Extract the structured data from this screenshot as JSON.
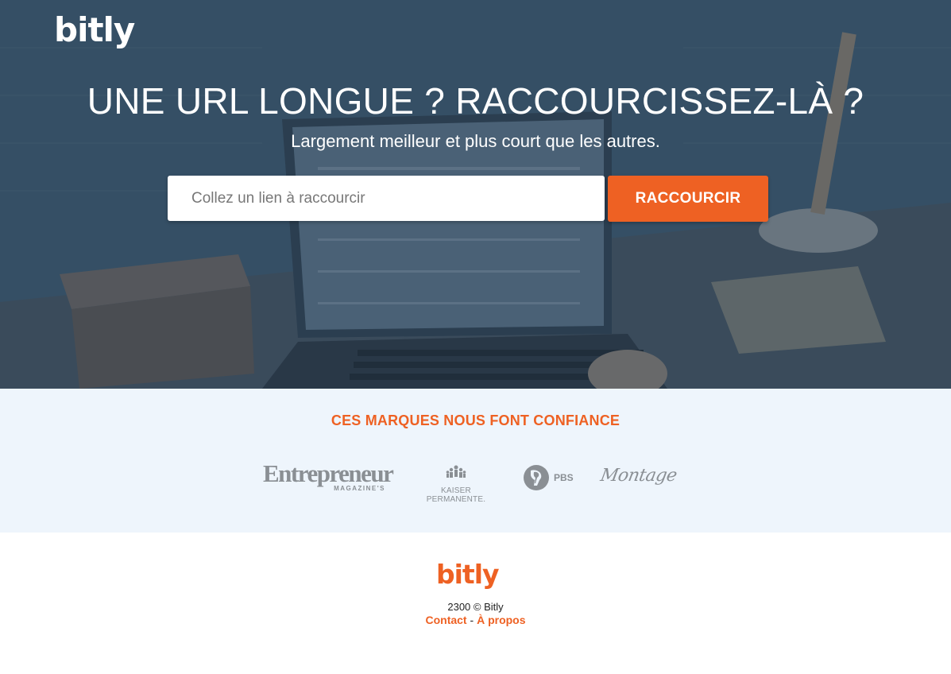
{
  "brand": {
    "logo_text": "bitly",
    "accent_color": "#ee6123"
  },
  "hero": {
    "title": "UNE URL LONGUE ? RACCOURCISSEZ-LÀ ?",
    "subtitle": "Largement meilleur et plus court que les autres.",
    "input_placeholder": "Collez un lien à raccourcir",
    "input_value": "",
    "button_label": "RACCOURCIR"
  },
  "brands": {
    "title": "CES MARQUES NOUS FONT CONFIANCE",
    "logos": [
      {
        "name": "Entrepreneur",
        "line1": "Entrepreneur",
        "line2": "MAGAZINE'S"
      },
      {
        "name": "Kaiser Permanente",
        "line1": "KAISER PERMANENTE."
      },
      {
        "name": "PBS",
        "line1": "PBS"
      },
      {
        "name": "Montage",
        "line1": "Montage"
      }
    ]
  },
  "footer": {
    "logo_text": "bitly",
    "copyright": "2300 © Bitly",
    "links": {
      "contact": "Contact",
      "separator": "-",
      "about": "À propos"
    }
  }
}
